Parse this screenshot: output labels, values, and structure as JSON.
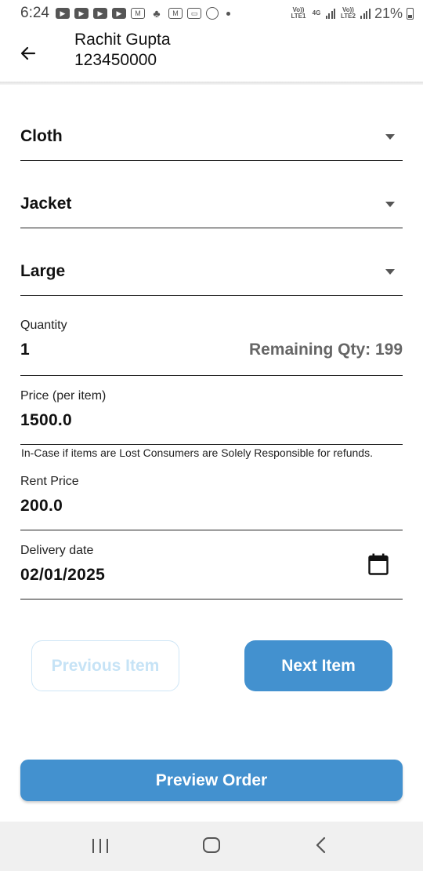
{
  "status_bar": {
    "time": "6:24",
    "network_1": "Vo)) LTE1",
    "network_gen": "4G",
    "network_2": "Vo)) LTE2",
    "battery": "21%",
    "icons": [
      "youtube-icon",
      "youtube-icon",
      "youtube-icon",
      "youtube-icon",
      "gmail-icon",
      "bank-icon",
      "gmail-icon",
      "tv-icon",
      "whatsapp-icon"
    ]
  },
  "header": {
    "name": "Rachit Gupta",
    "phone": "123450000"
  },
  "form": {
    "category": "Cloth",
    "item": "Jacket",
    "size": "Large",
    "quantity_label": "Quantity",
    "quantity_value": "1",
    "remaining_qty": "Remaining Qty: 199",
    "price_label": "Price (per item)",
    "price_value": "1500.0",
    "disclaimer": "In-Case if items are Lost Consumers are Solely Responsible for refunds.",
    "rent_label": "Rent Price",
    "rent_value": "200.0",
    "delivery_label": "Delivery date",
    "delivery_value": "02/01/2025"
  },
  "buttons": {
    "previous": "Previous Item",
    "next": "Next Item",
    "preview": "Preview Order"
  },
  "colors": {
    "primary": "#4391cf",
    "disabled_text": "#c6e3f6",
    "divider": "#222222"
  }
}
